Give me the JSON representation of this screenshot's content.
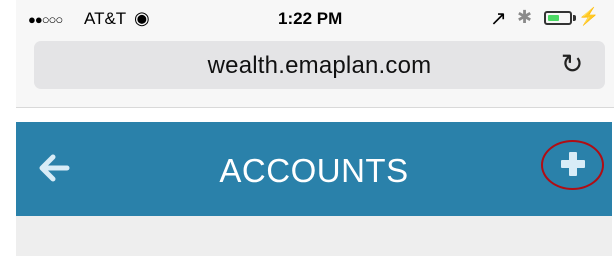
{
  "status_bar": {
    "signal": "●●○○○",
    "carrier": "AT&T",
    "wifi_icon": "wifi-icon",
    "time": "1:22 PM",
    "location_icon": "location-arrow-icon",
    "bluetooth_icon": "bluetooth-icon",
    "battery_icon": "battery-icon",
    "battery_level": 0.55,
    "charging_icon": "charging-bolt-icon"
  },
  "browser": {
    "url": "wealth.emaplan.com",
    "reload_icon": "reload-icon"
  },
  "nav": {
    "title": "ACCOUNTS",
    "back_icon": "back-arrow-icon",
    "add_icon": "plus-icon",
    "background_color": "#2a81aa",
    "annotation_color": "#b00d14"
  }
}
